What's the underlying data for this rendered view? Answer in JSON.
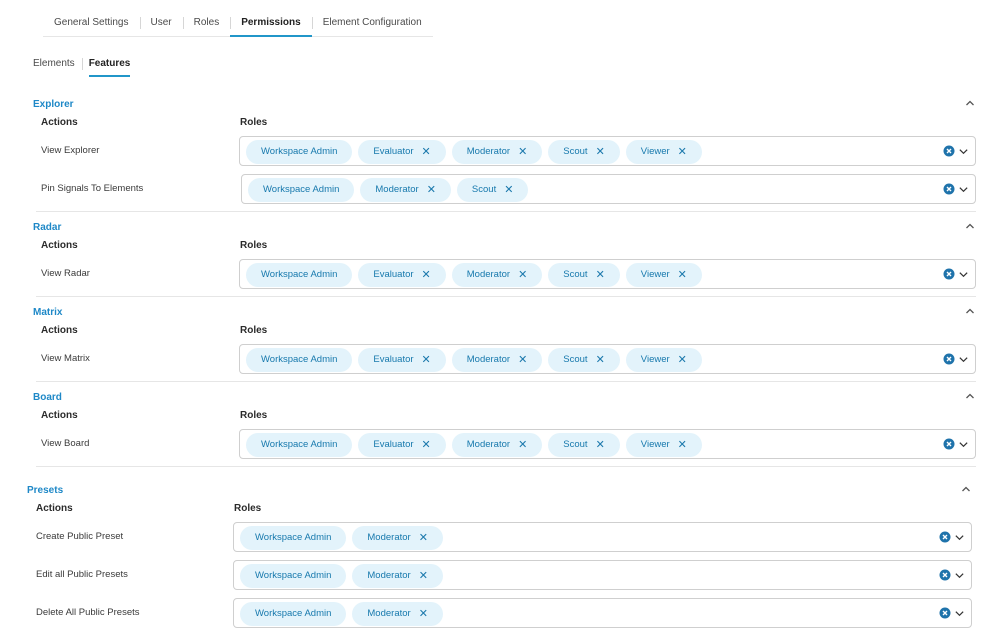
{
  "top_tabs": [
    {
      "label": "General Settings"
    },
    {
      "label": "User"
    },
    {
      "label": "Roles"
    },
    {
      "label": "Permissions",
      "active": true
    },
    {
      "label": "Element Configuration"
    }
  ],
  "sub_tabs": [
    {
      "label": "Elements"
    },
    {
      "label": "Features",
      "active": true
    }
  ],
  "columns": {
    "actions": "Actions",
    "roles": "Roles"
  },
  "remove_glyph": "✕",
  "icons": {
    "collapse": "chevron-up-icon",
    "clear": "clear-circle-icon",
    "dropdown": "chevron-down-icon"
  },
  "colors": {
    "accent": "#1e88c7",
    "chip_bg": "#e3f3fb",
    "chip_text": "#1779ad"
  },
  "sections": [
    {
      "title": "Explorer",
      "rows": [
        {
          "action": "View Explorer",
          "roles": [
            "Workspace Admin",
            "Evaluator",
            "Moderator",
            "Scout",
            "Viewer"
          ]
        },
        {
          "action": "Pin Signals To Elements",
          "roles": [
            "Workspace Admin",
            "Moderator",
            "Scout"
          ]
        }
      ]
    },
    {
      "title": "Radar",
      "rows": [
        {
          "action": "View Radar",
          "roles": [
            "Workspace Admin",
            "Evaluator",
            "Moderator",
            "Scout",
            "Viewer"
          ]
        }
      ]
    },
    {
      "title": "Matrix",
      "rows": [
        {
          "action": "View Matrix",
          "roles": [
            "Workspace Admin",
            "Evaluator",
            "Moderator",
            "Scout",
            "Viewer"
          ]
        }
      ]
    },
    {
      "title": "Board",
      "rows": [
        {
          "action": "View Board",
          "roles": [
            "Workspace Admin",
            "Evaluator",
            "Moderator",
            "Scout",
            "Viewer"
          ]
        }
      ]
    },
    {
      "title": "Presets",
      "rows": [
        {
          "action": "Create Public Preset",
          "roles": [
            "Workspace Admin",
            "Moderator"
          ]
        },
        {
          "action": "Edit all Public Presets",
          "roles": [
            "Workspace Admin",
            "Moderator"
          ]
        },
        {
          "action": "Delete All Public Presets",
          "roles": [
            "Workspace Admin",
            "Moderator"
          ]
        }
      ]
    }
  ]
}
